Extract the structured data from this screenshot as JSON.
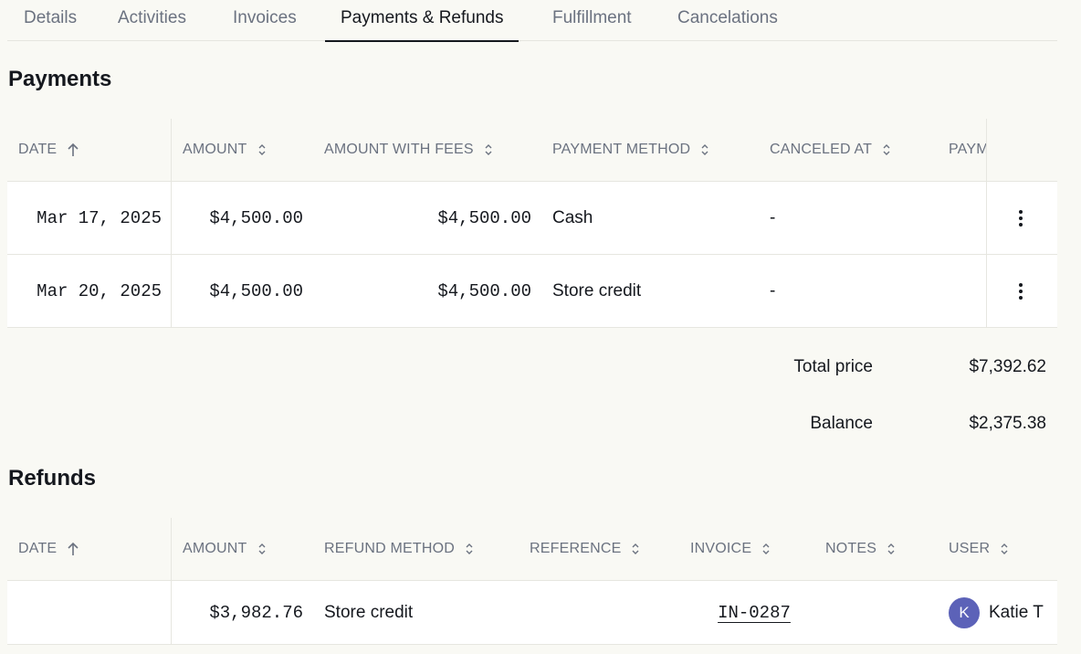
{
  "tabs": [
    "Details",
    "Activities",
    "Invoices",
    "Payments & Refunds",
    "Fulfillment",
    "Cancelations"
  ],
  "active_tab": "Payments & Refunds",
  "payments": {
    "title": "Payments",
    "columns": [
      "DATE",
      "AMOUNT",
      "AMOUNT WITH FEES",
      "PAYMENT METHOD",
      "CANCELED AT",
      "PAYM"
    ],
    "rows": [
      {
        "date": "Mar 17, 2025",
        "amount": "$4,500.00",
        "amount_with_fees": "$4,500.00",
        "method": "Cash",
        "canceled_at": "-"
      },
      {
        "date": "Mar 20, 2025",
        "amount": "$4,500.00",
        "amount_with_fees": "$4,500.00",
        "method": "Store credit",
        "canceled_at": "-"
      }
    ],
    "total_price_label": "Total price",
    "total_price": "$7,392.62",
    "balance_label": "Balance",
    "balance": "$2,375.38"
  },
  "refunds": {
    "title": "Refunds",
    "columns": [
      "DATE",
      "AMOUNT",
      "REFUND METHOD",
      "REFERENCE",
      "INVOICE",
      "NOTES",
      "USER"
    ],
    "rows": [
      {
        "date": "",
        "amount": "$3,982.76",
        "method": "Store credit",
        "reference": "",
        "invoice": "IN-0287",
        "notes": "",
        "user_initial": "K",
        "user": "Katie T"
      }
    ]
  },
  "colors": {
    "background": "#f9f9f4",
    "accent": "#15181e",
    "avatar": "#5c62b8",
    "muted": "#6b7280"
  },
  "icons": [
    "sort-up-arrow-icon",
    "sort-updown-icon",
    "more-vertical-icon"
  ]
}
